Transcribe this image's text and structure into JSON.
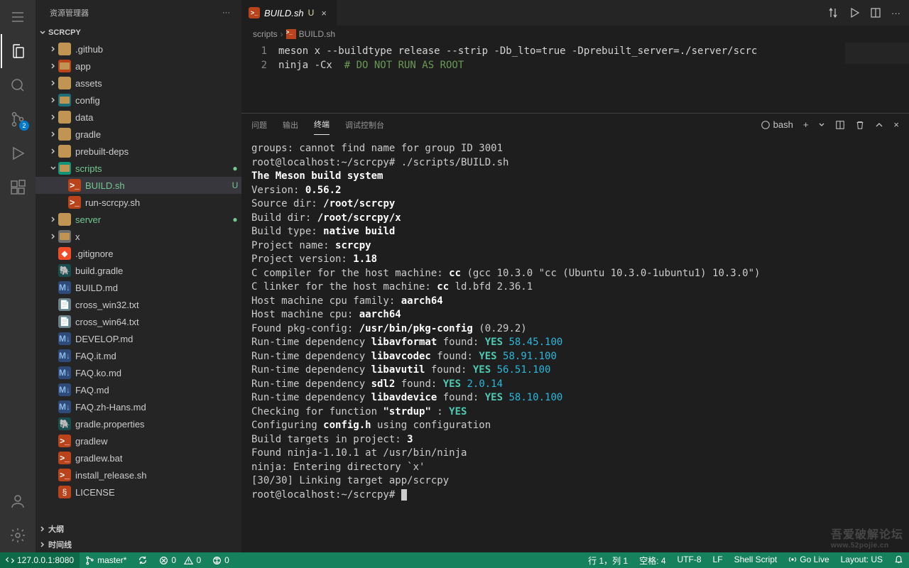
{
  "sidebar": {
    "title": "资源管理器",
    "project": "SCRCPY",
    "outline": "大纲",
    "timeline": "时间线",
    "scmBadge": "2",
    "tree": [
      {
        "depth": 1,
        "kind": "folder",
        "label": ".github",
        "chev": "r"
      },
      {
        "depth": 1,
        "kind": "folder",
        "label": "app",
        "chev": "r",
        "iconTint": "#b9431a"
      },
      {
        "depth": 1,
        "kind": "folder",
        "label": "assets",
        "chev": "r"
      },
      {
        "depth": 1,
        "kind": "folder",
        "label": "config",
        "chev": "r",
        "iconTint": "#1f6f78"
      },
      {
        "depth": 1,
        "kind": "folder",
        "label": "data",
        "chev": "r"
      },
      {
        "depth": 1,
        "kind": "folder",
        "label": "gradle",
        "chev": "r"
      },
      {
        "depth": 1,
        "kind": "folder",
        "label": "prebuilt-deps",
        "chev": "r"
      },
      {
        "depth": 1,
        "kind": "folder-open",
        "label": "scripts",
        "chev": "d",
        "green": true,
        "status": "●",
        "iconTint": "#129478"
      },
      {
        "depth": 2,
        "kind": "sh",
        "label": "BUILD.sh",
        "green": true,
        "status": "U",
        "selected": true
      },
      {
        "depth": 2,
        "kind": "sh",
        "label": "run-scrcpy.sh"
      },
      {
        "depth": 1,
        "kind": "folder",
        "label": "server",
        "chev": "r",
        "green": true,
        "status": "●"
      },
      {
        "depth": 1,
        "kind": "folder",
        "label": "x",
        "chev": "r",
        "iconTint": "#6d6d6d"
      },
      {
        "depth": 1,
        "kind": "git",
        "label": ".gitignore"
      },
      {
        "depth": 1,
        "kind": "gradle",
        "label": "build.gradle"
      },
      {
        "depth": 1,
        "kind": "md",
        "label": "BUILD.md"
      },
      {
        "depth": 1,
        "kind": "txt",
        "label": "cross_win32.txt"
      },
      {
        "depth": 1,
        "kind": "txt",
        "label": "cross_win64.txt"
      },
      {
        "depth": 1,
        "kind": "md",
        "label": "DEVELOP.md"
      },
      {
        "depth": 1,
        "kind": "md",
        "label": "FAQ.it.md"
      },
      {
        "depth": 1,
        "kind": "md",
        "label": "FAQ.ko.md"
      },
      {
        "depth": 1,
        "kind": "md",
        "label": "FAQ.md"
      },
      {
        "depth": 1,
        "kind": "md",
        "label": "FAQ.zh-Hans.md"
      },
      {
        "depth": 1,
        "kind": "gradle",
        "label": "gradle.properties"
      },
      {
        "depth": 1,
        "kind": "sh",
        "label": "gradlew"
      },
      {
        "depth": 1,
        "kind": "sh",
        "label": "gradlew.bat",
        "iconExt": "bat"
      },
      {
        "depth": 1,
        "kind": "sh",
        "label": "install_release.sh"
      },
      {
        "depth": 1,
        "kind": "lic",
        "label": "LICENSE"
      }
    ]
  },
  "tab": {
    "name": "BUILD.sh",
    "mod": "U"
  },
  "breadcrumb": {
    "p1": "scripts",
    "p2": "BUILD.sh"
  },
  "code": {
    "lines": [
      {
        "n": "1",
        "text": "meson x --buildtype release --strip -Db_lto=true -Dprebuilt_server=./server/scrc"
      },
      {
        "n": "2",
        "text": "ninja -Cx  ",
        "comment": "# DO NOT RUN AS ROOT"
      }
    ]
  },
  "panel": {
    "tabs": {
      "problems": "问题",
      "output": "输出",
      "terminal": "终端",
      "debug": "调试控制台"
    },
    "shell": "bash"
  },
  "terminal": [
    {
      "t": "groups: cannot find name for group ID 3001"
    },
    {
      "t": "root@localhost:~/scrcpy# ./scripts/BUILD.sh"
    },
    {
      "b": "The Meson build system"
    },
    {
      "frag": [
        {
          "t": "Version: "
        },
        {
          "b": "0.56.2"
        }
      ]
    },
    {
      "frag": [
        {
          "t": "Source dir: "
        },
        {
          "b": "/root/scrcpy"
        }
      ]
    },
    {
      "frag": [
        {
          "t": "Build dir: "
        },
        {
          "b": "/root/scrcpy/x"
        }
      ]
    },
    {
      "frag": [
        {
          "t": "Build type: "
        },
        {
          "b": "native build"
        }
      ]
    },
    {
      "frag": [
        {
          "t": "Project name: "
        },
        {
          "b": "scrcpy"
        }
      ]
    },
    {
      "frag": [
        {
          "t": "Project version: "
        },
        {
          "b": "1.18"
        }
      ]
    },
    {
      "frag": [
        {
          "t": "C compiler for the host machine: "
        },
        {
          "b": "cc"
        },
        {
          "t": " (gcc 10.3.0 \"cc (Ubuntu 10.3.0-1ubuntu1) 10.3.0\")"
        }
      ]
    },
    {
      "frag": [
        {
          "t": "C linker for the host machine: "
        },
        {
          "b": "cc"
        },
        {
          "t": " ld.bfd 2.36.1"
        }
      ]
    },
    {
      "frag": [
        {
          "t": "Host machine cpu family: "
        },
        {
          "b": "aarch64"
        }
      ]
    },
    {
      "frag": [
        {
          "t": "Host machine cpu: "
        },
        {
          "b": "aarch64"
        }
      ]
    },
    {
      "frag": [
        {
          "t": "Found pkg-config: "
        },
        {
          "b": "/usr/bin/pkg-config"
        },
        {
          "t": " (0.29.2)"
        }
      ]
    },
    {
      "frag": [
        {
          "t": "Run-time dependency "
        },
        {
          "b": "libavformat"
        },
        {
          "t": " found: "
        },
        {
          "g": "YES"
        },
        {
          "t": " "
        },
        {
          "c": "58.45.100"
        }
      ]
    },
    {
      "frag": [
        {
          "t": "Run-time dependency "
        },
        {
          "b": "libavcodec"
        },
        {
          "t": " found: "
        },
        {
          "g": "YES"
        },
        {
          "t": " "
        },
        {
          "c": "58.91.100"
        }
      ]
    },
    {
      "frag": [
        {
          "t": "Run-time dependency "
        },
        {
          "b": "libavutil"
        },
        {
          "t": " found: "
        },
        {
          "g": "YES"
        },
        {
          "t": " "
        },
        {
          "c": "56.51.100"
        }
      ]
    },
    {
      "frag": [
        {
          "t": "Run-time dependency "
        },
        {
          "b": "sdl2"
        },
        {
          "t": " found: "
        },
        {
          "g": "YES"
        },
        {
          "t": " "
        },
        {
          "c": "2.0.14"
        }
      ]
    },
    {
      "frag": [
        {
          "t": "Run-time dependency "
        },
        {
          "b": "libavdevice"
        },
        {
          "t": " found: "
        },
        {
          "g": "YES"
        },
        {
          "t": " "
        },
        {
          "c": "58.10.100"
        }
      ]
    },
    {
      "frag": [
        {
          "t": "Checking for function "
        },
        {
          "b": "\"strdup\""
        },
        {
          "t": " : "
        },
        {
          "g": "YES"
        }
      ]
    },
    {
      "frag": [
        {
          "t": "Configuring "
        },
        {
          "b": "config.h"
        },
        {
          "t": " using configuration"
        }
      ]
    },
    {
      "frag": [
        {
          "t": "Build targets in project: "
        },
        {
          "b": "3"
        }
      ]
    },
    {
      "t": ""
    },
    {
      "t": "Found ninja-1.10.1 at /usr/bin/ninja"
    },
    {
      "t": "ninja: Entering directory `x'"
    },
    {
      "t": "[30/30] Linking target app/scrcpy"
    },
    {
      "frag": [
        {
          "t": "root@localhost:~/scrcpy# "
        },
        {
          "cursor": true
        }
      ]
    }
  ],
  "status": {
    "remote": "127.0.0.1:8080",
    "branch": "master*",
    "errors": "0",
    "warnings": "0",
    "ports": "0",
    "lncol": "行 1，列 1",
    "spaces": "空格: 4",
    "enc": "UTF-8",
    "eol": "LF",
    "lang": "Shell Script",
    "golive": "Go Live",
    "layout": "Layout: US"
  },
  "watermark": {
    "big": "吾爱破解论坛",
    "small": "www.52pojie.cn"
  }
}
